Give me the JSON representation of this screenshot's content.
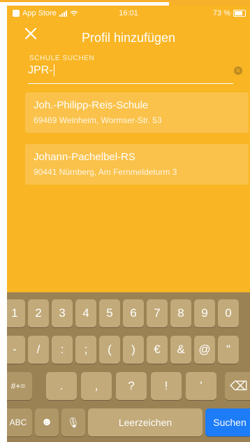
{
  "status_bar": {
    "carrier": "App Store",
    "time": "16:01",
    "battery": "73 %"
  },
  "header": {
    "title": "Profil hinzufügen"
  },
  "search": {
    "label": "SCHULE SUCHEN",
    "value": "JPR-"
  },
  "results": [
    {
      "name": "Joh.-Philipp-Reis-Schule",
      "address": "69469 Weinheim, Wormser-Str. 53"
    },
    {
      "name": "Johann-Pachelbel-RS",
      "address": "90441 Nürnberg, Am Fernmeldeturm 3"
    }
  ],
  "keyboard": {
    "row1": [
      "1",
      "2",
      "3",
      "4",
      "5",
      "6",
      "7",
      "8",
      "9",
      "0"
    ],
    "row2": [
      "-",
      "/",
      ":",
      ";",
      "(",
      ")",
      "€",
      "&",
      "@",
      "\""
    ],
    "row3": [
      "#+=",
      ".",
      ",",
      "?",
      "!",
      "'",
      "⌫"
    ],
    "row4": {
      "abc": "ABC",
      "emoji": "☻",
      "mic": "🎙",
      "space": "Leerzeichen",
      "search": "Suchen"
    }
  },
  "colors": {
    "background": "#f9b524",
    "keyboard": "#9a8255",
    "key": "#c2aa7a",
    "search_key": "#1d7cf7"
  }
}
